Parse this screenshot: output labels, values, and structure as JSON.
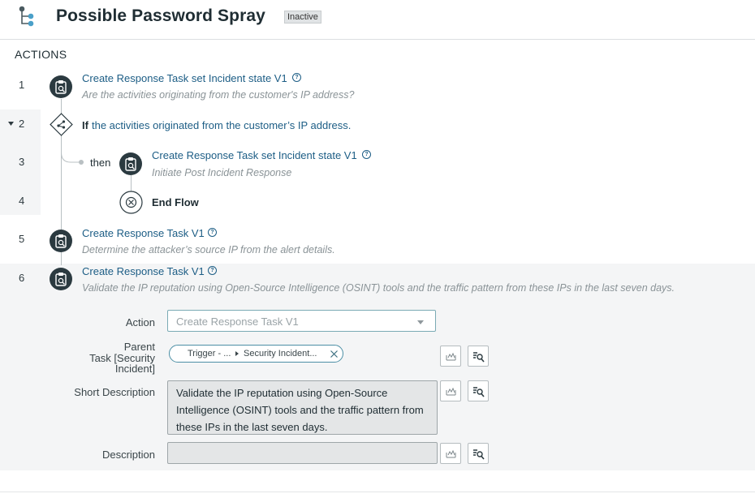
{
  "header": {
    "title": "Possible Password Spray",
    "status": "Inactive"
  },
  "section": {
    "label": "ACTIONS"
  },
  "steps": [
    {
      "num": "1",
      "title": "Create Response Task set Incident state V1",
      "subtitle": "Are the activities originating from the customer's IP address?"
    },
    {
      "num": "2",
      "if_keyword": "If",
      "condition": "the activities originated from the customer’s IP address."
    },
    {
      "num": "3",
      "branch_label": "then",
      "title": "Create Response Task set Incident state V1",
      "subtitle": "Initiate Post Incident Response"
    },
    {
      "num": "4",
      "title": "End Flow"
    },
    {
      "num": "5",
      "title": "Create Response Task V1",
      "subtitle": "Determine the attacker’s source IP from the alert details."
    },
    {
      "num": "6",
      "title": "Create Response Task V1",
      "subtitle": "Validate the IP reputation using Open-Source Intelligence (OSINT) tools and the traffic pattern from these IPs in the last seven days."
    }
  ],
  "form": {
    "action_label": "Action",
    "action_placeholder": "Create Response Task V1",
    "parent_label_1": "Parent",
    "parent_label_2": "Task [Security",
    "parent_label_3": "Incident]",
    "parent_chip_part1": "Trigger - ...",
    "parent_chip_part2": "Security Incident...",
    "short_desc_label": "Short Description",
    "short_desc_value": "Validate the IP reputation using Open-Source Intelligence (OSINT) tools and the traffic pattern from these IPs in the last seven days.",
    "description_label": "Description"
  },
  "colors": {
    "link": "#1c5d85",
    "icon_dark": "#2b3a40",
    "selected_bg": "#f4f5f6"
  }
}
